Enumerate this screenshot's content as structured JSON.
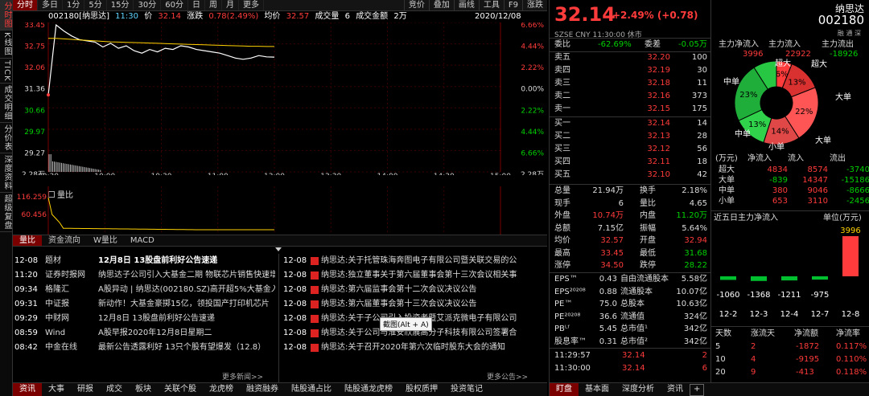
{
  "left_tabs": [
    "分时图",
    "K线图",
    "TICK",
    "成交明细",
    "分价表",
    "深度资料",
    "超级复盘"
  ],
  "toolbar": {
    "tabs": [
      "分时",
      "多日",
      "1分",
      "5分",
      "15分",
      "30分",
      "60分",
      "日",
      "周",
      "月",
      "更多"
    ],
    "right": [
      "竞价",
      "叠加",
      "画线",
      "工具",
      "F9",
      "涨跌"
    ]
  },
  "info": {
    "code_name": "002180[纳思达]",
    "time": "11:30",
    "price_label": "价",
    "price": "32.14",
    "chg_label": "涨跌",
    "chg": "0.78(2.49%)",
    "avg_label": "均价",
    "avg": "32.57",
    "vol_label": "成交量",
    "vol": "6",
    "amt_label": "成交金额",
    "amt": "2万",
    "date": "2020/12/08"
  },
  "main_axis": {
    "left": [
      "33.45",
      "32.75",
      "32.06",
      "31.36",
      "30.66",
      "29.97",
      "29.27",
      "2.28万"
    ],
    "right": [
      "6.66%",
      "4.44%",
      "2.22%",
      "0.00%",
      "2.22%",
      "4.44%",
      "6.66%",
      "2.28万"
    ],
    "times": [
      "09:30",
      "10:00",
      "10:30",
      "11:00",
      "13:00",
      "13:30",
      "14:00",
      "14:30",
      "15:00"
    ]
  },
  "vol_axis": {
    "title": "量比",
    "left": [
      "116.259",
      "60.456"
    ]
  },
  "sub_tabs": [
    "量比",
    "资金流向",
    "W量比",
    "MACD"
  ],
  "news_left": [
    [
      "12-08",
      "题材",
      "12月8日 13股盘前利好公告速递"
    ],
    [
      "11:20",
      "证券时报网",
      "纳思达子公司引入大基金二期 物联芯片销售快速增长"
    ],
    [
      "09:34",
      "格隆汇",
      "A股异动 | 纳思达(002180.SZ)高开超5%大基金入股"
    ],
    [
      "09:31",
      "中证报",
      "新动作！大基金豪掷15亿，领投国产打印机芯片"
    ],
    [
      "09:29",
      "中财网",
      "12月8日 13股盘前利好公告速递"
    ],
    [
      "08:59",
      "Wind",
      "A股早报2020年12月8日星期二"
    ],
    [
      "08:42",
      "中金在线",
      "最新公告透露利好 13只个股有望爆发（12.8）"
    ]
  ],
  "news_right": [
    [
      "12-08",
      "纳思达:关于托管珠海奔图电子有限公司暨关联交易的公告"
    ],
    [
      "12-08",
      "纳思达:独立董事关于第六届董事会第十三次会议相关事项的独立意见"
    ],
    [
      "12-08",
      "纳思达:第六届监事会第十二次会议决议公告"
    ],
    [
      "12-08",
      "纳思达:第六届董事会第十三次会议决议公告"
    ],
    [
      "12-08",
      "纳思达:关于子公司引入投资者暨艾派克微电子有限公司增资的公告"
    ],
    [
      "12-08",
      "纳思达:关于公司与淮安欣展高分子科技有限公司签署合同的公告"
    ],
    [
      "12-08",
      "纳思达:关于召开2020年第六次临时股东大会的通知"
    ]
  ],
  "tooltip": "截图(Alt + A)",
  "more_news": "更多新闻>>",
  "more_ann": "更多公告>>",
  "bottom_tabs": [
    "资讯",
    "大事",
    "研报",
    "成交",
    "板块",
    "关联个股",
    "龙虎榜",
    "融资融券",
    "陆股通占比",
    "陆股通龙虎榜",
    "股权质押",
    "投资笔记"
  ],
  "quote": {
    "price": "32.14",
    "change": "+2.49% (+0.78)",
    "name": "纳思达",
    "code": "002180",
    "sub": "SZSE  CNY  11:30:00  休市",
    "tags": "融 通 深",
    "weibi_label": "委比",
    "weibi": "-62.69%",
    "weicha_label": "委差",
    "weicha": "-0.05万",
    "asks": [
      [
        "卖五",
        "32.20",
        "100"
      ],
      [
        "卖四",
        "32.19",
        "30"
      ],
      [
        "卖三",
        "32.18",
        "11"
      ],
      [
        "卖二",
        "32.16",
        "373"
      ],
      [
        "卖一",
        "32.15",
        "175"
      ]
    ],
    "bids": [
      [
        "买一",
        "32.14",
        "14"
      ],
      [
        "买二",
        "32.13",
        "28"
      ],
      [
        "买三",
        "32.12",
        "56"
      ],
      [
        "买四",
        "32.11",
        "18"
      ],
      [
        "买五",
        "32.10",
        "42"
      ]
    ],
    "stats": [
      [
        "总量",
        "21.94万",
        "换手",
        "2.18%"
      ],
      [
        "现手",
        "6",
        "量比",
        "4.65"
      ],
      [
        "外盘",
        "10.74万",
        "内盘",
        "11.20万"
      ],
      [
        "总额",
        "7.15亿",
        "振幅",
        "5.64%"
      ],
      [
        "均价",
        "32.57",
        "开盘",
        "32.94"
      ],
      [
        "最高",
        "33.45",
        "最低",
        "31.68"
      ],
      [
        "涨停",
        "34.50",
        "跌停",
        "28.22"
      ]
    ],
    "fund": [
      [
        "EPS™",
        "0.43",
        "自由流通股本",
        "5.58亿"
      ],
      [
        "EPS²⁰²⁰⁸",
        "0.88",
        "流通股本",
        "10.07亿"
      ],
      [
        "PE™",
        "75.0",
        "总股本",
        "10.63亿"
      ],
      [
        "PE²⁰²⁰⁸",
        "36.6",
        "流通值",
        "324亿"
      ],
      [
        "PBᴸᶠ",
        "5.45",
        "总市值¹",
        "342亿"
      ],
      [
        "股息率™",
        "0.31",
        "总市值²",
        "342亿"
      ]
    ],
    "ticks": [
      [
        "11:29:57",
        "32.14",
        "2"
      ],
      [
        "11:30:00",
        "32.14",
        "6"
      ]
    ]
  },
  "flow": {
    "in_label": "主力净流入",
    "in": "3996",
    "flow_in_label": "主力流入",
    "flow_in": "22922",
    "flow_out_label": "主力流出",
    "flow_out": "-18926",
    "pie": [
      {
        "label": "超大",
        "pct": 6,
        "color": "#ff3b3b"
      },
      {
        "label": "大单",
        "pct": 13,
        "color": "#d93030"
      },
      {
        "label": "大单",
        "pct": 22,
        "color": "#ff5555"
      },
      {
        "label": "中单",
        "pct": 14,
        "color": "#e04848"
      },
      {
        "label": "中单",
        "pct": 13,
        "color": "#2fd24a"
      },
      {
        "label": "大单",
        "pct": 23,
        "color": "#1fae3a"
      },
      {
        "label": "小单",
        "pct": 9,
        "color": "#27c743"
      }
    ],
    "pie_text": [
      "6%",
      "13%",
      "22%",
      "14%",
      "13%",
      "23%"
    ],
    "pie_labels": [
      "超大",
      "超大",
      "大单",
      "大单",
      "中单",
      "中单",
      "小单"
    ],
    "table_head": [
      "(万元)",
      "净流入",
      "流入",
      "流出"
    ],
    "table": [
      [
        "超大",
        "4834",
        "8574",
        "-3740"
      ],
      [
        "大单",
        "-839",
        "14347",
        "-15186"
      ],
      [
        "中单",
        "380",
        "9046",
        "-8666"
      ],
      [
        "小单",
        "653",
        "3110",
        "-2456"
      ]
    ],
    "five_title": "近五日主力净流入",
    "five_unit": "单位(万元)",
    "five_values": [
      -1060,
      -1368,
      -1211,
      -975,
      3996
    ],
    "five_labels": [
      "-1060",
      "-1368",
      "-1211",
      "-975",
      "3996"
    ],
    "five_dates": [
      "12-2",
      "12-3",
      "12-4",
      "12-7",
      "12-8"
    ],
    "days_head": [
      "天数",
      "涨流天",
      "净流额",
      "净流率"
    ],
    "days": [
      [
        "5",
        "2",
        "-1872",
        "0.117%"
      ],
      [
        "10",
        "4",
        "-9195",
        "0.110%"
      ],
      [
        "20",
        "9",
        "-413",
        "0.118%"
      ]
    ]
  },
  "right_tabs": [
    "盯盘",
    "基本面",
    "深度分析",
    "资讯"
  ],
  "colors": {
    "up": "#ff3b3b",
    "down": "#00d000",
    "avg": "#ffd200",
    "price_line": "#ffffff"
  },
  "chart_data": {
    "type": "line",
    "xlabel": "",
    "ylabel": "",
    "series": [
      {
        "name": "",
        "values": [
          30.6,
          33.45,
          33.2,
          33.0,
          32.85,
          32.8,
          32.75,
          32.55,
          32.7,
          32.5,
          32.6,
          32.4,
          32.3,
          32.45,
          32.35,
          32.5,
          32.45,
          32.6,
          32.55,
          32.45,
          32.4,
          32.35,
          32.3,
          32.2,
          32.1,
          32.05,
          32.1,
          32.2,
          32.15,
          32.14
        ]
      },
      {
        "name": "",
        "values": [
          32.9,
          32.9,
          32.88,
          32.86,
          32.84,
          32.82,
          32.8,
          32.78,
          32.76,
          32.75,
          32.74,
          32.73,
          32.72,
          32.71,
          32.7,
          32.69,
          32.68,
          32.67,
          32.66,
          32.65,
          32.64,
          32.63,
          32.62,
          32.61,
          32.6,
          32.59,
          32.58,
          32.58,
          32.57,
          32.57
        ]
      }
    ],
    "ylim": [
      28.22,
      33.45
    ]
  }
}
